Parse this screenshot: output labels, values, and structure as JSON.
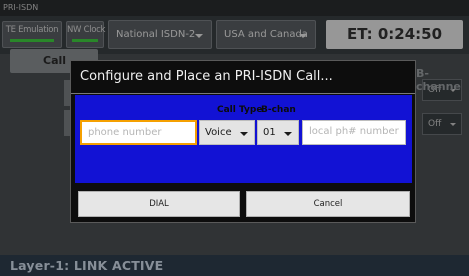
{
  "window": {
    "title": "PRI-ISDN"
  },
  "topbar": {
    "te_emulation": "TE Emulation",
    "nw_clock": "NW Clock",
    "interface_select": "National ISDN-2",
    "region_select": "USA and Canada",
    "elapsed_time": "ET: 0:24:50"
  },
  "main": {
    "call_button": "Call",
    "b_channel_header": "B-channe",
    "side_select_1": "Off",
    "side_select_2": "Off"
  },
  "status_bar": {
    "text": "Layer-1: LINK ACTIVE"
  },
  "dialog": {
    "title": "Configure and Place an PRI-ISDN Call...",
    "headers": {
      "call_type": "Call Type",
      "b_chan": "B-chan"
    },
    "phone_placeholder": "phone number",
    "call_type_value": "Voice",
    "b_chan_value": "01",
    "local_placeholder": "local ph# number",
    "dial_button": "DIAL",
    "cancel_button": "Cancel"
  },
  "colors": {
    "panel_blue": "#1212d4",
    "led_green": "#3fd03f",
    "focus_orange": "#f5a000",
    "status_bar": "#2f3e4e"
  }
}
